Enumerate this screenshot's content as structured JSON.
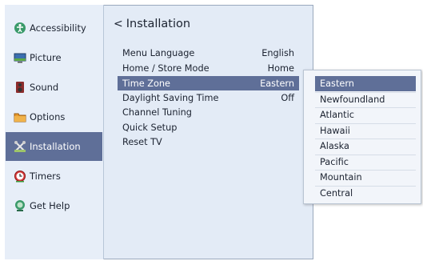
{
  "sidebar": {
    "items": [
      {
        "label": "Accessibility",
        "icon": "accessibility-icon"
      },
      {
        "label": "Picture",
        "icon": "picture-icon"
      },
      {
        "label": "Sound",
        "icon": "sound-icon"
      },
      {
        "label": "Options",
        "icon": "options-icon"
      },
      {
        "label": "Installation",
        "icon": "installation-icon",
        "active": true
      },
      {
        "label": "Timers",
        "icon": "timers-icon"
      },
      {
        "label": "Get Help",
        "icon": "get-help-icon"
      }
    ]
  },
  "main": {
    "title": "Installation",
    "back_glyph": "<",
    "rows": [
      {
        "label": "Menu Language",
        "value": "English"
      },
      {
        "label": "Home / Store Mode",
        "value": "Home"
      },
      {
        "label": "Time Zone",
        "value": "Eastern",
        "active": true
      },
      {
        "label": "Daylight Saving Time",
        "value": "Off"
      },
      {
        "label": "Channel Tuning",
        "value": ""
      },
      {
        "label": "Quick Setup",
        "value": ""
      },
      {
        "label": "Reset TV",
        "value": ""
      }
    ]
  },
  "timezone_popup": {
    "options": [
      "Eastern",
      "Newfoundland",
      "Atlantic",
      "Hawaii",
      "Alaska",
      "Pacific",
      "Mountain",
      "Central"
    ],
    "selected": "Eastern"
  },
  "colors": {
    "highlight": "#5f6f98",
    "panel": "#e3ebf6",
    "popup_bg": "#f2f5fa"
  }
}
